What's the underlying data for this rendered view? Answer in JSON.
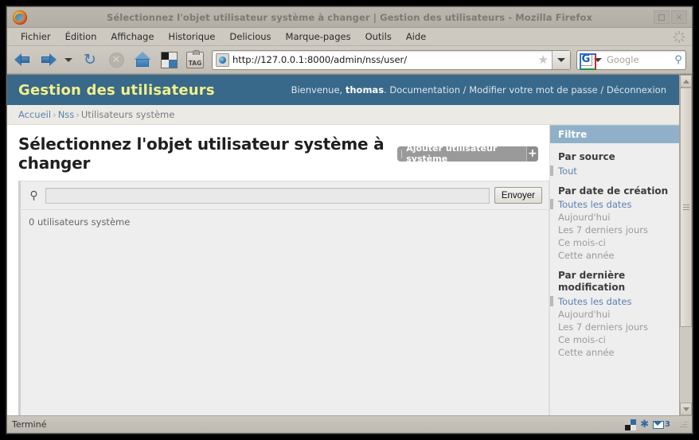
{
  "window": {
    "title": "Sélectionnez l'objet utilisateur système à changer | Gestion des utilisateurs - Mozilla Firefox",
    "app_icon": "firefox-icon",
    "controls": {
      "maximize": "maximize-icon",
      "close": "×"
    }
  },
  "menubar": {
    "items": [
      {
        "label": "Fichier"
      },
      {
        "label": "Édition"
      },
      {
        "label": "Affichage"
      },
      {
        "label": "Historique"
      },
      {
        "label": "Delicious"
      },
      {
        "label": "Marque-pages"
      },
      {
        "label": "Outils"
      },
      {
        "label": "Aide"
      }
    ]
  },
  "toolbar": {
    "back": "back-arrow-icon",
    "forward": "forward-arrow-icon",
    "history_dropdown": "chevron-down-icon",
    "reload": "↻",
    "stop": "✕",
    "home": "home-icon",
    "checker": "checker-icon",
    "tag_label": "TAG",
    "url": "http://127.0.0.1:8000/admin/nss/user/",
    "bookmark_star": "★",
    "url_dropdown": "chevron-down-icon",
    "search_engine": "G",
    "search_placeholder": "Google",
    "search_magnifier": "search-icon"
  },
  "page": {
    "branding": "Gestion des utilisateurs",
    "welcome_prefix": "Bienvenue, ",
    "username": "thomas",
    "welcome_suffix": ". Documentation / Modifier votre mot de passe / Déconnexion",
    "breadcrumb": {
      "home": "Accueil",
      "app": "Nss",
      "current": "Utilisateurs système",
      "separator": "›"
    },
    "title": "Sélectionnez l'objet utilisateur système à changer",
    "add_button": "Ajouter utilisateur système",
    "add_plus": "+",
    "search_icon": "search-icon",
    "search_value": "",
    "search_placeholder": "",
    "submit_button": "Envoyer",
    "result_count": "0 utilisateurs système"
  },
  "filter": {
    "heading": "Filtre",
    "groups": [
      {
        "title": "Par source",
        "options": [
          {
            "label": "Tout",
            "selected": true
          }
        ]
      },
      {
        "title": "Par date de création",
        "options": [
          {
            "label": "Toutes les dates",
            "selected": true
          },
          {
            "label": "Aujourd'hui",
            "selected": false
          },
          {
            "label": "Les 7 derniers jours",
            "selected": false
          },
          {
            "label": "Ce mois-ci",
            "selected": false
          },
          {
            "label": "Cette année",
            "selected": false
          }
        ]
      },
      {
        "title": "Par dernière modification",
        "options": [
          {
            "label": "Toutes les dates",
            "selected": true
          },
          {
            "label": "Aujourd'hui",
            "selected": false
          },
          {
            "label": "Les 7 derniers jours",
            "selected": false
          },
          {
            "label": "Ce mois-ci",
            "selected": false
          },
          {
            "label": "Cette année",
            "selected": false
          }
        ]
      }
    ]
  },
  "statusbar": {
    "text": "Terminé",
    "icons": [
      {
        "name": "checker-icon"
      },
      {
        "name": "snowflake-icon",
        "glyph": "✱"
      },
      {
        "name": "mail-icon",
        "count": "3"
      }
    ]
  },
  "colors": {
    "header_bg": "#38698a",
    "branding": "#f3f08b",
    "link": "#5b80b2",
    "filter_head_bg": "#8fb0c8",
    "panel_bg": "#eeeeee"
  }
}
